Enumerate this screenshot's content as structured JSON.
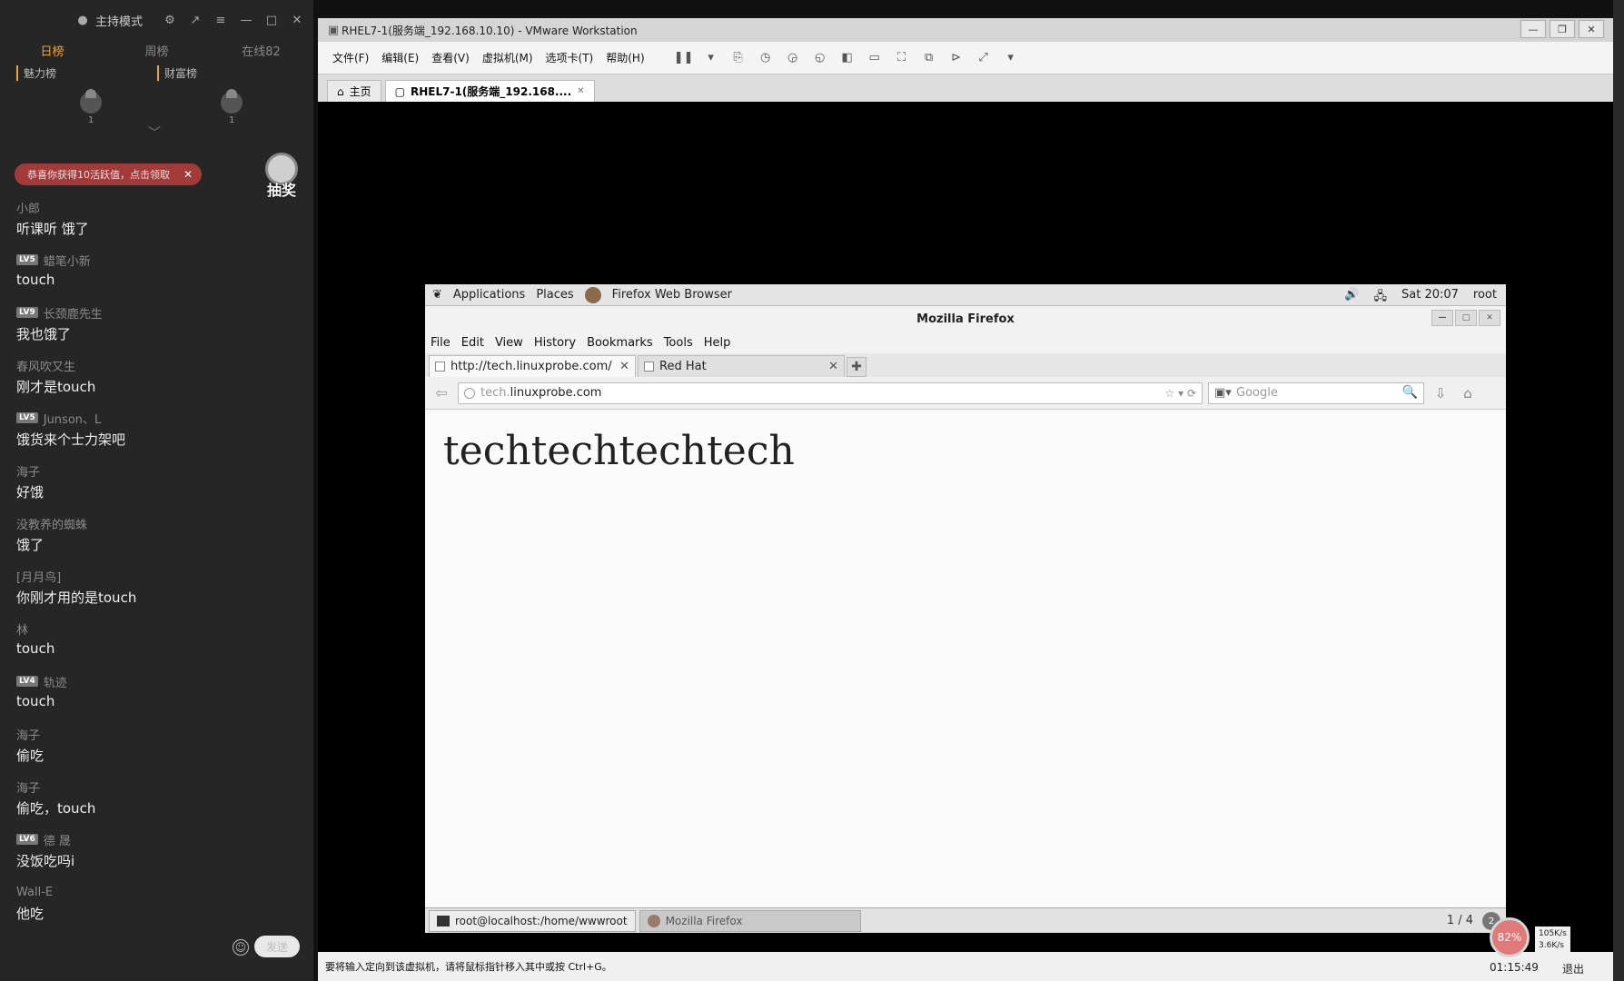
{
  "chat": {
    "header": {
      "mode": "主持模式"
    },
    "tabs": [
      "日榜",
      "周榜",
      "在线82"
    ],
    "rank": {
      "charm_label": "魅力榜",
      "wealth_label": "财富榜",
      "charm_count": "1",
      "wealth_count": "1"
    },
    "banner": "恭喜你获得10活跃值，点击领取",
    "lottery_label": "抽奖",
    "messages": [
      {
        "name": "小郎",
        "level": "",
        "text": "听课听 饿了"
      },
      {
        "name": "蜡笔小新",
        "level": "LV5",
        "text": "touch"
      },
      {
        "name": "长颈鹿先生",
        "level": "LV9",
        "text": "我也饿了"
      },
      {
        "name": "春风吹又生",
        "level": "",
        "text": "刚才是touch"
      },
      {
        "name": "Junson、L",
        "level": "LV5",
        "text": "饿货来个士力架吧"
      },
      {
        "name": "海子",
        "level": "",
        "text": "好饿"
      },
      {
        "name": "没教养的蜘蛛",
        "level": "",
        "text": "饿了"
      },
      {
        "name": "[月月鸟]",
        "level": "",
        "text": "你刚才用的是touch"
      },
      {
        "name": "林",
        "level": "",
        "text": "touch"
      },
      {
        "name": "轨迹",
        "level": "LV4",
        "text": "touch"
      },
      {
        "name": "海子",
        "level": "",
        "text": "偷吃"
      },
      {
        "name": "海子",
        "level": "",
        "text": "偷吃，touch"
      },
      {
        "name": "德 晟",
        "level": "LV6",
        "text": "没饭吃吗i"
      },
      {
        "name": "Wall-E",
        "level": "",
        "text": "他吃"
      }
    ],
    "send_label": "发送"
  },
  "vmware": {
    "title": "RHEL7-1(服务端_192.168.10.10) - VMware Workstation",
    "menu": [
      "文件(F)",
      "编辑(E)",
      "查看(V)",
      "虚拟机(M)",
      "选项卡(T)",
      "帮助(H)"
    ],
    "tabs": [
      {
        "label": "主页"
      },
      {
        "label": "RHEL7-1(服务端_192.168...."
      }
    ],
    "status": "要将输入定向到该虚拟机，请将鼠标指针移入其中或按 Ctrl+G。"
  },
  "guest": {
    "topbar": {
      "applications": "Applications",
      "places": "Places",
      "app_name": "Firefox Web Browser",
      "clock": "Sat 20:07",
      "user": "root"
    },
    "window_title": "Mozilla Firefox",
    "menu": [
      "File",
      "Edit",
      "View",
      "History",
      "Bookmarks",
      "Tools",
      "Help"
    ],
    "tabs": [
      {
        "label": "http://tech.linuxprobe.com/"
      },
      {
        "label": "Red Hat"
      }
    ],
    "url_prefix": "tech.",
    "url_domain": "linuxprobe.com",
    "search_placeholder": "Google",
    "page_heading": "techtechtechtech",
    "taskbar": [
      {
        "label": "root@localhost:/home/wwwroot"
      },
      {
        "label": "Mozilla Firefox"
      }
    ],
    "workspace": "1 / 4",
    "workspace_badge": "2"
  },
  "network": {
    "percent": "82%",
    "up": "105K/s",
    "down": "3.6K/s",
    "clock": "01:15:49",
    "exit": "退出"
  }
}
